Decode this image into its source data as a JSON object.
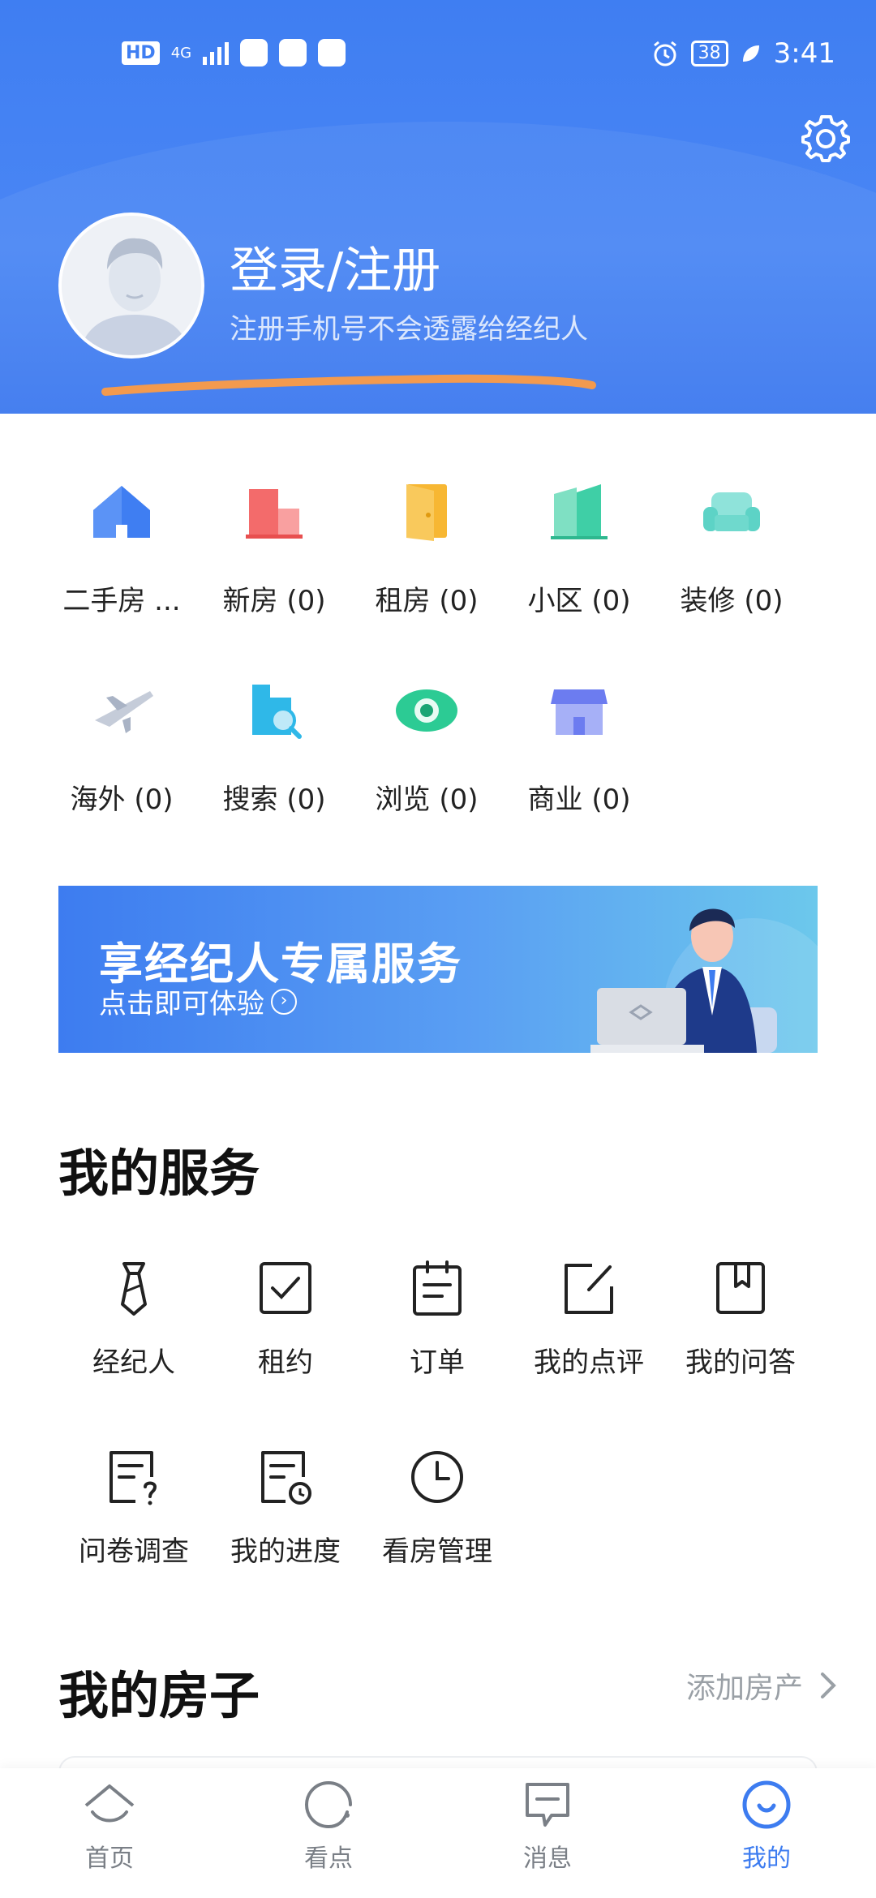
{
  "status_bar": {
    "hd": "HD",
    "network": "4G",
    "battery": "38",
    "time": "3:41"
  },
  "profile": {
    "title": "登录/注册",
    "subtitle": "注册手机号不会透露给经纪人"
  },
  "categories": [
    {
      "label": "二手房 ...",
      "icon": "house-icon",
      "color": "#3f7ef2"
    },
    {
      "label": "新房 (0)",
      "icon": "building-icon",
      "color": "#f36b6b"
    },
    {
      "label": "租房 (0)",
      "icon": "door-icon",
      "color": "#f7b733"
    },
    {
      "label": "小区 (0)",
      "icon": "community-icon",
      "color": "#3fcfa6"
    },
    {
      "label": "装修 (0)",
      "icon": "sofa-icon",
      "color": "#5dd3c6"
    },
    {
      "label": "海外 (0)",
      "icon": "plane-icon",
      "color": "#b9c2d3"
    },
    {
      "label": "搜索 (0)",
      "icon": "search-book-icon",
      "color": "#2fb8e8"
    },
    {
      "label": "浏览 (0)",
      "icon": "eye-icon",
      "color": "#2ccb94"
    },
    {
      "label": "商业 (0)",
      "icon": "shop-icon",
      "color": "#6c7cf0"
    }
  ],
  "banner": {
    "title": "享经纪人专属服务",
    "subtitle": "点击即可体验"
  },
  "services": {
    "title": "我的服务",
    "items": [
      {
        "label": "经纪人",
        "icon": "tie-icon"
      },
      {
        "label": "租约",
        "icon": "checkbox-icon"
      },
      {
        "label": "订单",
        "icon": "clipboard-icon"
      },
      {
        "label": "我的点评",
        "icon": "edit-icon"
      },
      {
        "label": "我的问答",
        "icon": "bookmark-icon"
      },
      {
        "label": "问卷调查",
        "icon": "questionnaire-icon"
      },
      {
        "label": "我的进度",
        "icon": "progress-doc-icon"
      },
      {
        "label": "看房管理",
        "icon": "clock-icon"
      }
    ]
  },
  "houses": {
    "title": "我的房子",
    "add_label": "添加房产"
  },
  "bottom_nav": [
    {
      "label": "首页",
      "icon": "home-icon",
      "active": false
    },
    {
      "label": "看点",
      "icon": "discover-icon",
      "active": false
    },
    {
      "label": "消息",
      "icon": "message-icon",
      "active": false
    },
    {
      "label": "我的",
      "icon": "profile-icon",
      "active": true
    }
  ],
  "colors": {
    "header_blue": "#3f7ef2",
    "active_nav": "#3d7cf0",
    "underline_orange": "#f39a4e"
  }
}
